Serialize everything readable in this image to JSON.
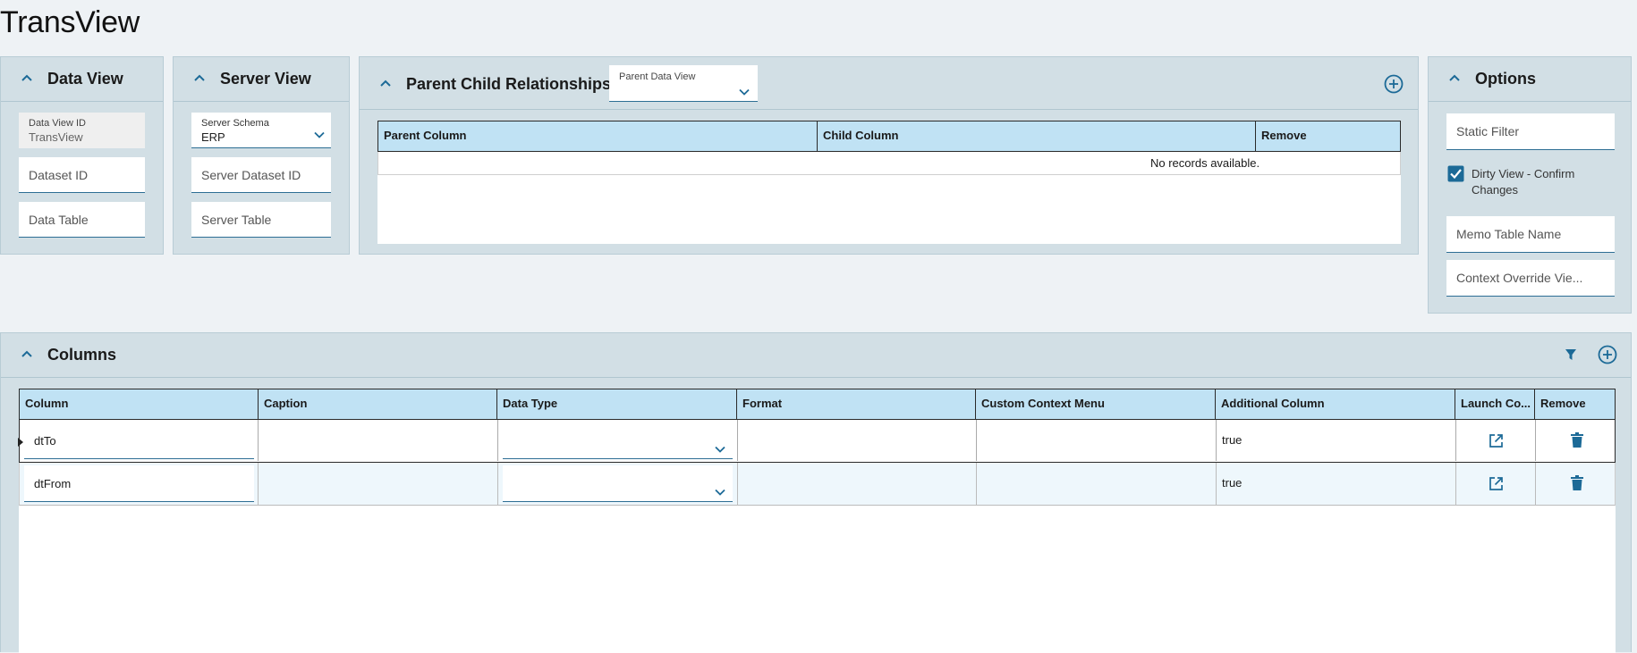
{
  "app": {
    "title": "TransView"
  },
  "data_view": {
    "title": "Data View",
    "id_label": "Data View ID",
    "id_value": "TransView",
    "dataset_placeholder": "Dataset ID",
    "table_placeholder": "Data Table"
  },
  "server_view": {
    "title": "Server View",
    "schema_label": "Server Schema",
    "schema_value": "ERP",
    "dataset_placeholder": "Server Dataset ID",
    "table_placeholder": "Server Table"
  },
  "relationships": {
    "title": "Parent Child Relationships",
    "parent_data_view_label": "Parent Data View",
    "parent_data_view_value": "",
    "columns": [
      "Parent Column",
      "Child Column",
      "Remove"
    ],
    "empty_text": "No records available."
  },
  "options": {
    "title": "Options",
    "static_filter_placeholder": "Static Filter",
    "dirty_view_label_1": "Dirty View - Confirm",
    "dirty_view_label_2": "Changes",
    "dirty_view_checked": true,
    "memo_table_placeholder": "Memo Table Name",
    "context_override_placeholder": "Context Override Vie..."
  },
  "columns_panel": {
    "title": "Columns",
    "headers": [
      "Column",
      "Caption",
      "Data Type",
      "Format",
      "Custom Context Menu",
      "Additional Column",
      "Launch Co...",
      "Remove"
    ],
    "rows": [
      {
        "column": "dtTo",
        "caption": "",
        "data_type": "",
        "format": "",
        "custom_context_menu": "",
        "additional_column": "true"
      },
      {
        "column": "dtFrom",
        "caption": "",
        "data_type": "",
        "format": "",
        "custom_context_menu": "",
        "additional_column": "true"
      }
    ]
  },
  "colors": {
    "accent": "#1c6a97",
    "panel_bg": "#d2dfe5",
    "header_bg": "#c0e2f4",
    "page_bg": "#eef2f5",
    "alt_row": "#eef7fc"
  },
  "icons": {
    "collapse": "chevron-up-icon",
    "dropdown": "chevron-down-icon",
    "add": "plus-circle-icon",
    "filter": "filter-icon",
    "launch": "external-link-icon",
    "delete": "trash-icon",
    "checkbox": "checkbox-checked-icon",
    "row_indicator": "caret-right-icon"
  }
}
